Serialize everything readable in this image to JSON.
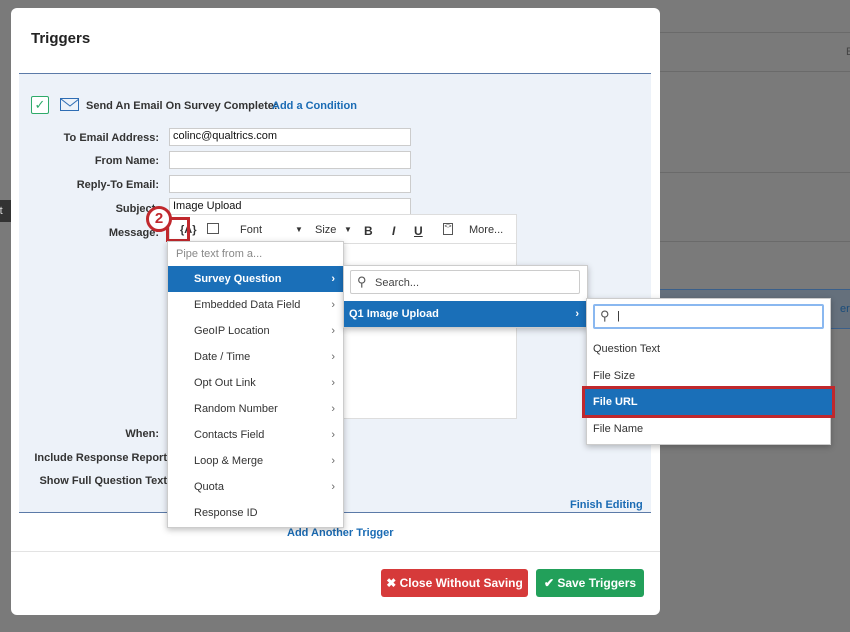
{
  "background": {
    "left_text": "rt",
    "right_top_text": "E",
    "right_mid_text": "ermi"
  },
  "modal": {
    "title": "Triggers"
  },
  "trigger": {
    "heading": "Send An Email On Survey Complete:",
    "add_condition": "Add a Condition"
  },
  "form": {
    "to_label": "To Email Address:",
    "to_value": "colinc@qualtrics.com",
    "from_label": "From Name:",
    "from_value": "",
    "reply_label": "Reply-To Email:",
    "reply_value": "",
    "subject_label": "Subject:",
    "subject_value": "Image Upload",
    "message_label": "Message:",
    "when_label": "When:",
    "include_label": "Include Response Report",
    "include_checked": true,
    "show_label": "Show Full Question Text",
    "show_checked": false
  },
  "toolbar": {
    "pipe": "{A}",
    "font": "Font",
    "size": "Size",
    "bold": "B",
    "italic": "I",
    "underline": "U",
    "more": "More..."
  },
  "step_badge": "2",
  "pipe_menu": {
    "header": "Pipe text from a...",
    "items": [
      {
        "label": "Survey Question",
        "sub": true
      },
      {
        "label": "Embedded Data Field",
        "sub": true
      },
      {
        "label": "GeoIP Location",
        "sub": true
      },
      {
        "label": "Date / Time",
        "sub": true
      },
      {
        "label": "Opt Out Link",
        "sub": true
      },
      {
        "label": "Random Number",
        "sub": true
      },
      {
        "label": "Contacts Field",
        "sub": true
      },
      {
        "label": "Loop & Merge",
        "sub": true
      },
      {
        "label": "Quota",
        "sub": true
      },
      {
        "label": "Response ID",
        "sub": false
      }
    ]
  },
  "question_menu": {
    "search_placeholder": "Search...",
    "items": [
      {
        "label": "Q1 Image Upload"
      }
    ]
  },
  "field_menu": {
    "search_value": "|",
    "items": [
      "Question Text",
      "File Size",
      "File URL",
      "File Name"
    ]
  },
  "finish_editing": "Finish Editing",
  "add_trigger": "Add Another Trigger",
  "footer": {
    "close": "Close Without Saving",
    "save": "Save Triggers"
  },
  "colors": {
    "accent": "#1a6fb8",
    "danger": "#d63a3a",
    "success": "#22a05a",
    "highlight": "#c0282d"
  }
}
